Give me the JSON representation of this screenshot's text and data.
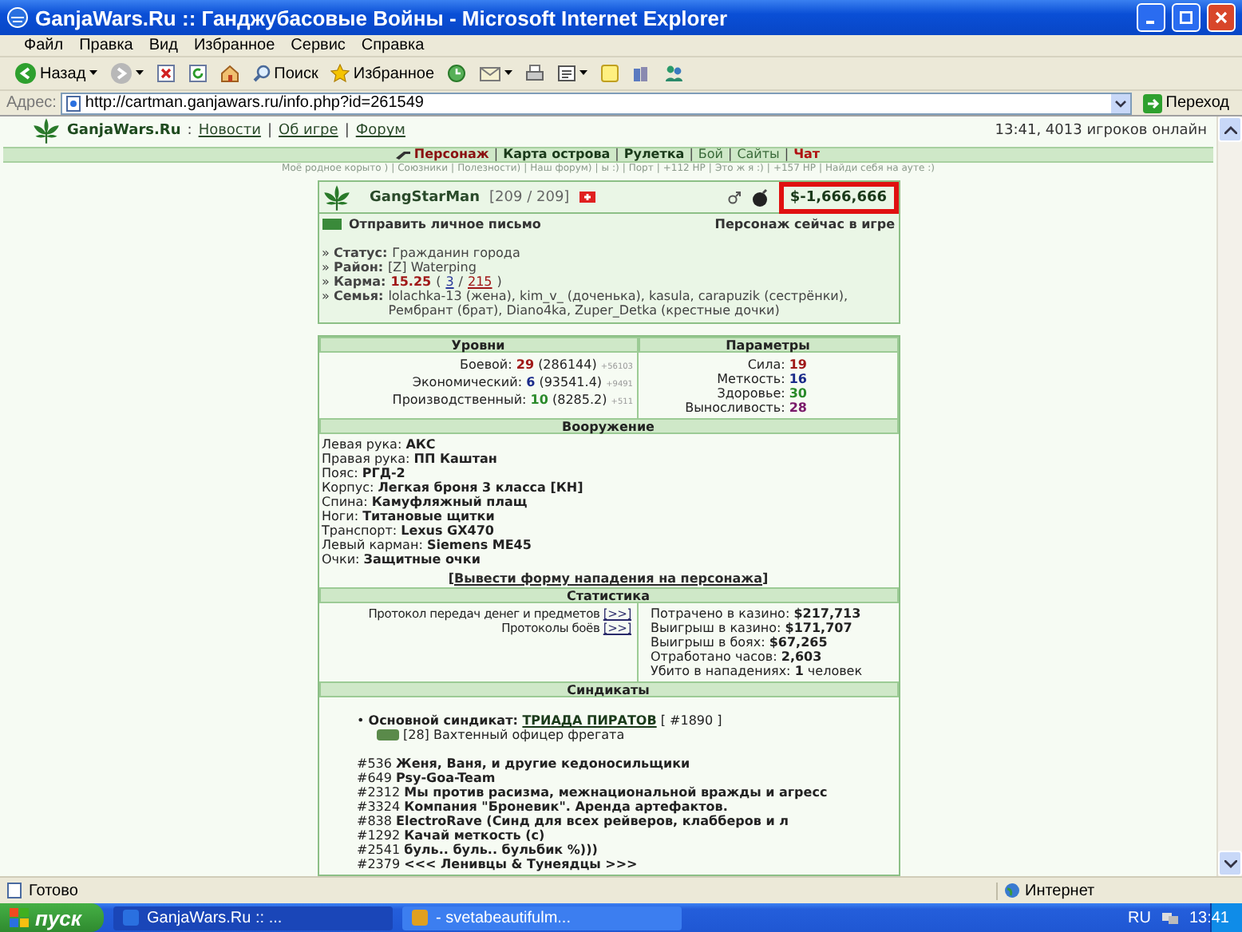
{
  "window": {
    "title": "GanjaWars.Ru :: Ганджубасовые Войны - Microsoft Internet Explorer"
  },
  "menu": [
    "Файл",
    "Правка",
    "Вид",
    "Избранное",
    "Сервис",
    "Справка"
  ],
  "toolbar": [
    {
      "kind": "back",
      "label": "Назад",
      "dropdown": true
    },
    {
      "kind": "forward",
      "dropdown": true
    },
    {
      "kind": "stop",
      "dropdown": false
    },
    {
      "kind": "refresh",
      "dropdown": false
    },
    {
      "kind": "home",
      "dropdown": false
    },
    {
      "kind": "search",
      "label": "Поиск",
      "dropdown": false
    },
    {
      "kind": "favorites",
      "label": "Избранное",
      "dropdown": false
    },
    {
      "kind": "history",
      "dropdown": false
    },
    {
      "kind": "mail",
      "dropdown": true
    },
    {
      "kind": "print",
      "dropdown": false
    },
    {
      "kind": "edit",
      "dropdown": true
    },
    {
      "kind": "note",
      "dropdown": false
    },
    {
      "kind": "research",
      "dropdown": false
    },
    {
      "kind": "messenger",
      "dropdown": false
    }
  ],
  "address": {
    "label": "Адрес:",
    "value": "http://cartman.ganjawars.ru/info.php?id=261549",
    "go": "Переход"
  },
  "site_header": {
    "logo": "GanjaWars.Ru",
    "separator": ":",
    "links": [
      "Новости",
      "Об игре",
      "Форум"
    ],
    "divider": "|",
    "online": "13:41, 4013 игроков онлайн"
  },
  "nav": [
    {
      "label": "Персонаж",
      "kind": "current"
    },
    {
      "label": "Карта острова",
      "kind": "main"
    },
    {
      "label": "Рулетка",
      "kind": "main"
    },
    {
      "label": "Бой",
      "kind": "minor"
    },
    {
      "label": "Сайты",
      "kind": "minor"
    },
    {
      "label": "Чат",
      "kind": "alert"
    }
  ],
  "nav_divider": "|",
  "sublinks": [
    "Моё родное корыто )",
    "Союзники",
    "Полезности)",
    "Наш форум)",
    "ы :)",
    "Порт",
    "+112 HP",
    "Это ж я :)",
    "+157 HP",
    "Найди себя на ауте :)"
  ],
  "character": {
    "name": "GangStarMan",
    "hp": "[209 / 209]",
    "money": "$-1,666,666",
    "send_message": "Отправить личное письмо",
    "presence": "Персонаж сейчас в игре",
    "info": [
      {
        "kind": "text",
        "marker": "»",
        "label": "Статус:",
        "value": "Гражданин города"
      },
      {
        "kind": "text",
        "marker": "»",
        "label": "Район:",
        "value": "[Z] Waterping"
      },
      {
        "kind": "karma",
        "marker": "»",
        "label": "Карма:",
        "value": "15.25",
        "detail": [
          {
            "text": "(",
            "link": false
          },
          {
            "text": "3",
            "link": true,
            "color": "#2a3a9a"
          },
          {
            "text": "/",
            "link": false
          },
          {
            "text": "215",
            "link": true,
            "color": "#a01818"
          },
          {
            "text": ")",
            "link": false
          }
        ]
      },
      {
        "kind": "text",
        "marker": "»",
        "label": "Семья:",
        "value": "lolachka-13 (жена), kim_v_ (доченька), kasula, carapuzik (сестрёнки), Рембрант (брат), Diano4ka, Zuper_Detka (крестные дочки)"
      }
    ]
  },
  "levels": {
    "heading": "Уровни",
    "rows": [
      {
        "label": "Боевой:",
        "value": "29",
        "detail": "(286144)",
        "gain": "+56103",
        "color": "#a01818"
      },
      {
        "label": "Экономический:",
        "value": "6",
        "detail": "(93541.4)",
        "gain": "+9491",
        "color": "#1a2a8a"
      },
      {
        "label": "Производственный:",
        "value": "10",
        "detail": "(8285.2)",
        "gain": "+511",
        "color": "#2a8a2a"
      }
    ]
  },
  "params": {
    "heading": "Параметры",
    "rows": [
      {
        "label": "Сила:",
        "value": "19",
        "color": "#a01818"
      },
      {
        "label": "Меткость:",
        "value": "16",
        "color": "#1a2a8a"
      },
      {
        "label": "Здоровье:",
        "value": "30",
        "color": "#2a8a2a"
      },
      {
        "label": "Выносливость:",
        "value": "28",
        "color": "#7a1a6a"
      }
    ]
  },
  "armament": {
    "heading": "Вооружение",
    "rows": [
      {
        "label": "Левая рука:",
        "value": "АКС"
      },
      {
        "label": "Правая рука:",
        "value": "ПП Каштан"
      },
      {
        "label": "Пояс:",
        "value": "РГД-2"
      },
      {
        "label": "Корпус:",
        "value": "Легкая броня 3 класса [КН]"
      },
      {
        "label": "Спина:",
        "value": "Камуфляжный плащ"
      },
      {
        "label": "Ноги:",
        "value": "Титановые щитки"
      },
      {
        "label": "Транспорт:",
        "value": "Lexus GX470"
      },
      {
        "label": "Левый карман:",
        "value": "Siemens ME45"
      },
      {
        "label": "Очки:",
        "value": "Защитные очки"
      }
    ],
    "attack": {
      "open": "[",
      "text": "Вывести форму нападения на персонажа",
      "close": "]"
    }
  },
  "statistics": {
    "heading": "Статистика",
    "logs": [
      {
        "label": "Протокол передач денег и предметов",
        "link": "[>>]"
      },
      {
        "label": "Протоколы боёв",
        "link": "[>>]"
      }
    ],
    "rows": [
      {
        "label": "Потрачено в казино:",
        "value": "$217,713"
      },
      {
        "label": "Выигрыш в казино:",
        "value": "$171,707"
      },
      {
        "label": "Выигрыш в боях:",
        "value": "$67,265"
      },
      {
        "label": "Отработано часов:",
        "value": "2,603"
      },
      {
        "label": "Убито в нападениях:",
        "value": "1",
        "unit": "человек"
      }
    ]
  },
  "syndicates": {
    "heading": "Синдикаты",
    "main": {
      "bullet": "•",
      "label": "Основной синдикат:",
      "name": "ТРИАДА ПИРАТОВ",
      "id": "[ #1890 ]",
      "rank": "[28] Вахтенный офицер фрегата"
    },
    "list": [
      {
        "id": "#536",
        "name": "Женя, Ваня, и другие кедоносильщики"
      },
      {
        "id": "#649",
        "name": "Psy-Goa-Team"
      },
      {
        "id": "#2312",
        "name": "Мы против расизма, межнациональной вражды и агресс"
      },
      {
        "id": "#3324",
        "name": "Компания \"Броневик\". Аренда артефактов."
      },
      {
        "id": "#838",
        "name": "ElectroRave (Синд для всех рейверов, клабберов и л"
      },
      {
        "id": "#1292",
        "name": "Качай меткость (c)"
      },
      {
        "id": "#2541",
        "name": "буль.. буль.. бульбик %)))"
      },
      {
        "id": "#2379",
        "name": "<<< Ленивцы & Тунеядцы >>>"
      }
    ]
  },
  "status_bar": {
    "text": "Готово",
    "zone": "Интернет"
  },
  "taskbar": {
    "start": "пуск",
    "tasks": [
      {
        "label": "GanjaWars.Ru :: ...",
        "selected": true
      },
      {
        "label": "- svetabeautifulm...",
        "selected": false
      }
    ],
    "lang": "RU",
    "clock": "13:41"
  }
}
